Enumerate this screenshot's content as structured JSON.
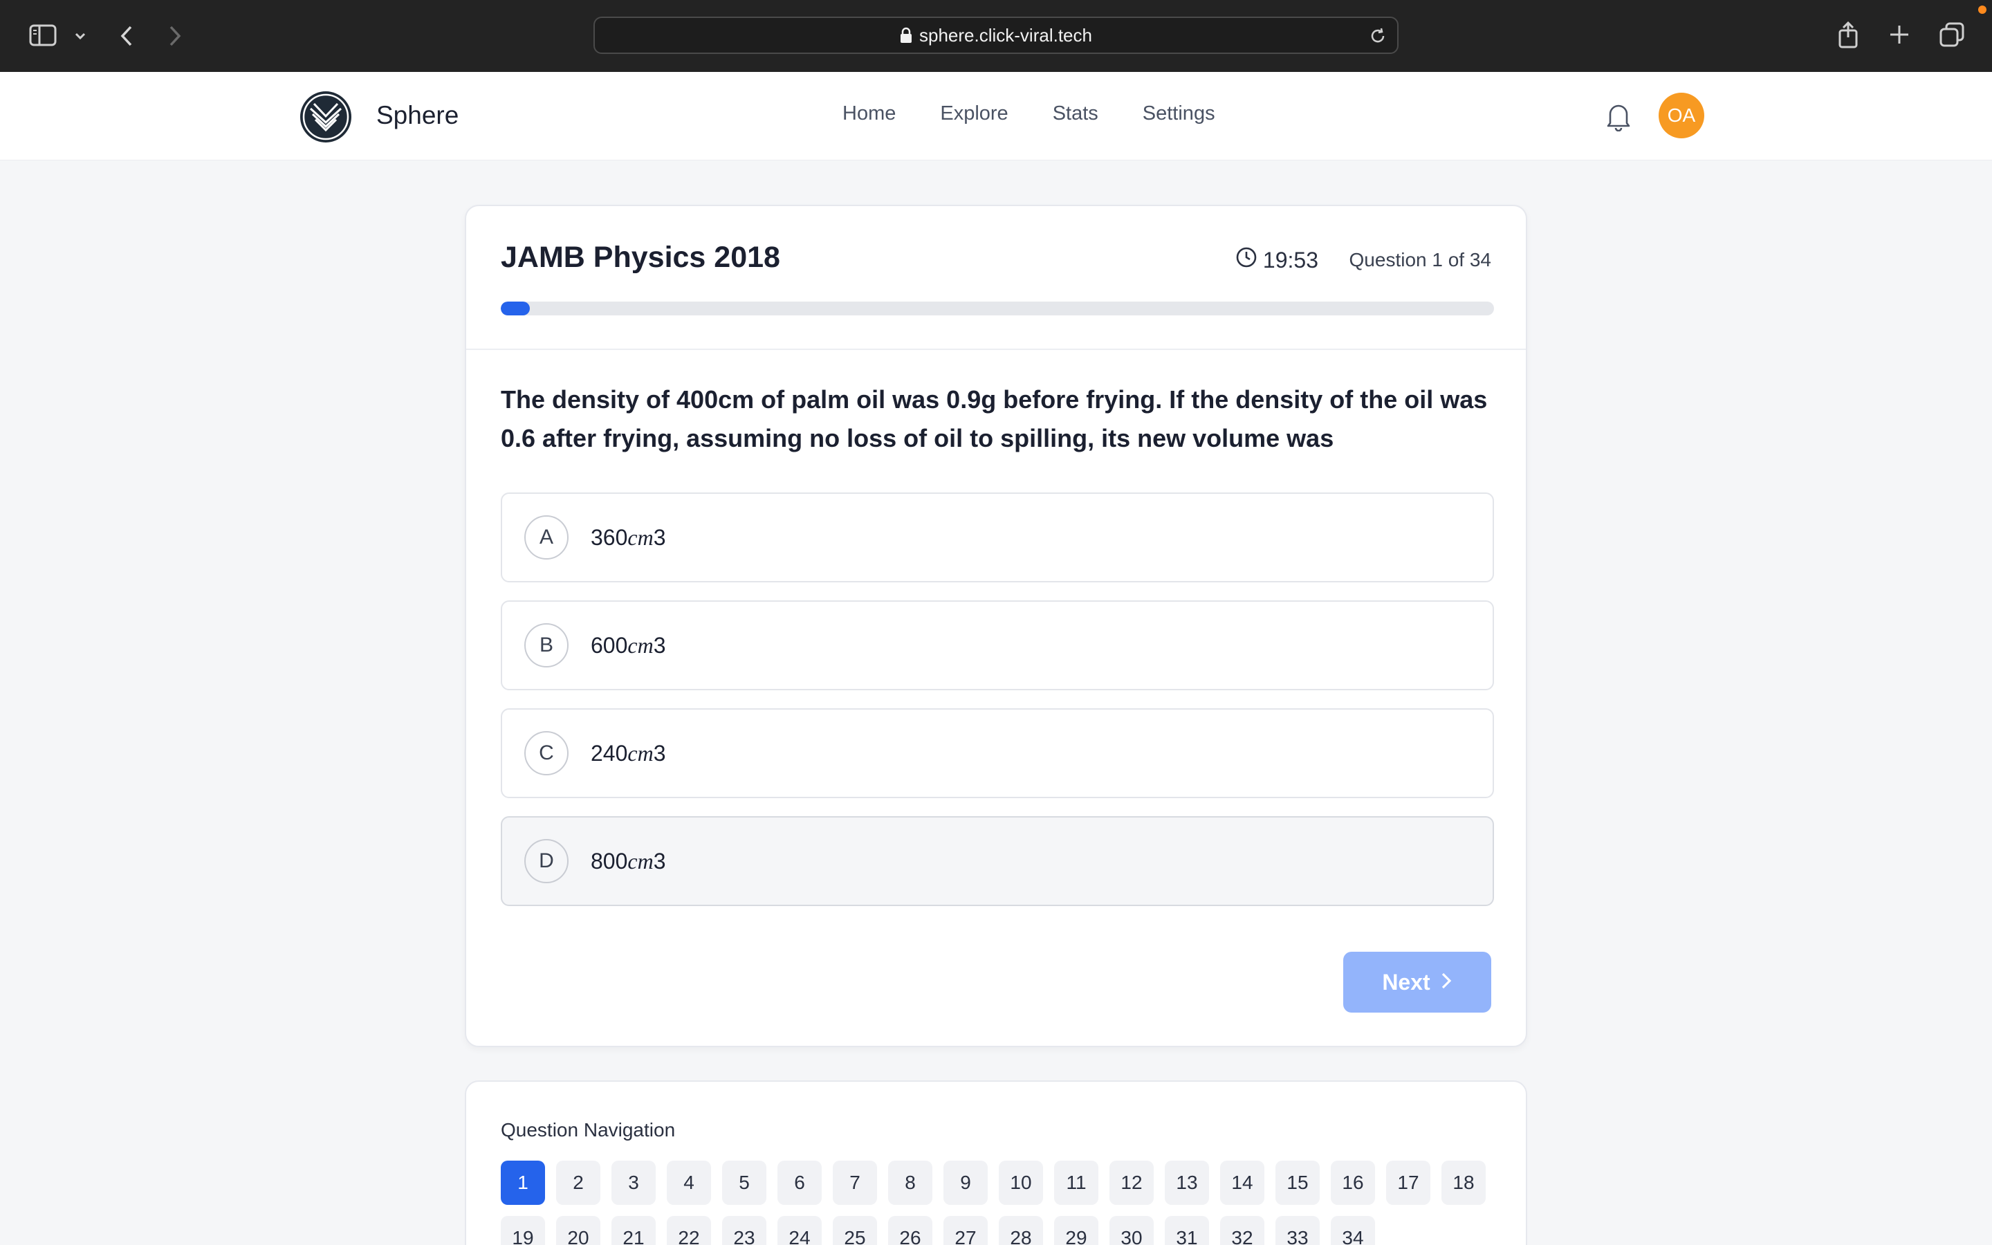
{
  "browser": {
    "url": "sphere.click-viral.tech",
    "icons": [
      "sidebar-icon",
      "chevron-down-icon",
      "back-arrow-icon",
      "forward-arrow-icon",
      "lock-icon",
      "reload-icon",
      "share-icon",
      "new-tab-icon",
      "tabs-overview-icon"
    ],
    "notification_dot_color": "#ff8a1d"
  },
  "header": {
    "brand": "Sphere",
    "nav": [
      "Home",
      "Explore",
      "Stats",
      "Settings"
    ],
    "avatar_initials": "OA",
    "avatar_color": "#f79a22"
  },
  "quiz": {
    "title": "JAMB Physics 2018",
    "timer": "19:53",
    "question_count": "Question 1 of 34",
    "progress_fraction": 0.029,
    "question": "The density of 400cm of palm oil was 0.9g before frying. If the density of the oil was 0.6 after frying, assuming no loss of oil to spilling, its new volume was",
    "options": [
      {
        "letter": "A",
        "value": "360",
        "unit": "cm",
        "suffix": "3",
        "selected": false
      },
      {
        "letter": "B",
        "value": "600",
        "unit": "cm",
        "suffix": "3",
        "selected": false
      },
      {
        "letter": "C",
        "value": "240",
        "unit": "cm",
        "suffix": "3",
        "selected": false
      },
      {
        "letter": "D",
        "value": "800",
        "unit": "cm",
        "suffix": "3",
        "selected": true
      }
    ],
    "next_label": "Next",
    "accent_color": "#2563eb"
  },
  "navigation": {
    "title": "Question Navigation",
    "current": 1,
    "questions": [
      "1",
      "2",
      "3",
      "4",
      "5",
      "6",
      "7",
      "8",
      "9",
      "10",
      "11",
      "12",
      "13",
      "14",
      "15",
      "16",
      "17",
      "18",
      "19",
      "20",
      "21",
      "22",
      "23",
      "24",
      "25",
      "26",
      "27",
      "28",
      "29",
      "30",
      "31",
      "32",
      "33",
      "34"
    ]
  }
}
